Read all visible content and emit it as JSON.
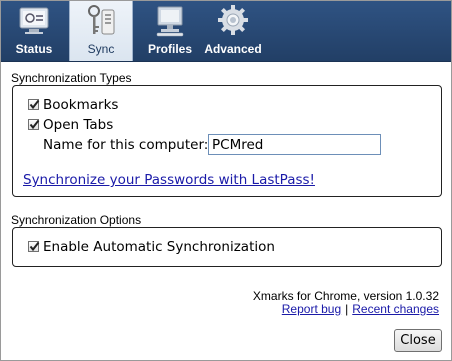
{
  "tabs": [
    {
      "label": "Status",
      "icon": "status-monitor-icon",
      "active": false
    },
    {
      "label": "Sync",
      "icon": "sync-keys-icon",
      "active": true
    },
    {
      "label": "Profiles",
      "icon": "profiles-computer-icon",
      "active": false
    },
    {
      "label": "Advanced",
      "icon": "advanced-gear-icon",
      "active": false
    }
  ],
  "sync_types": {
    "title": "Synchronization Types",
    "bookmarks_label": "Bookmarks",
    "bookmarks_checked": true,
    "open_tabs_label": "Open Tabs",
    "open_tabs_checked": true,
    "computer_name_label": "Name for this computer:",
    "computer_name_value": "PCMred",
    "lastpass_link": "Synchronize your Passwords with LastPass!"
  },
  "sync_options": {
    "title": "Synchronization Options",
    "auto_sync_label": "Enable Automatic Synchronization",
    "auto_sync_checked": true
  },
  "footer": {
    "version_text": "Xmarks for Chrome, version 1.0.32",
    "report_bug": "Report bug",
    "separator": "|",
    "recent_changes": "Recent changes",
    "close_button": "Close"
  },
  "colors": {
    "toolbar": "#2f5383",
    "link": "#1a1aa8",
    "input_border": "#6d8fb8"
  }
}
